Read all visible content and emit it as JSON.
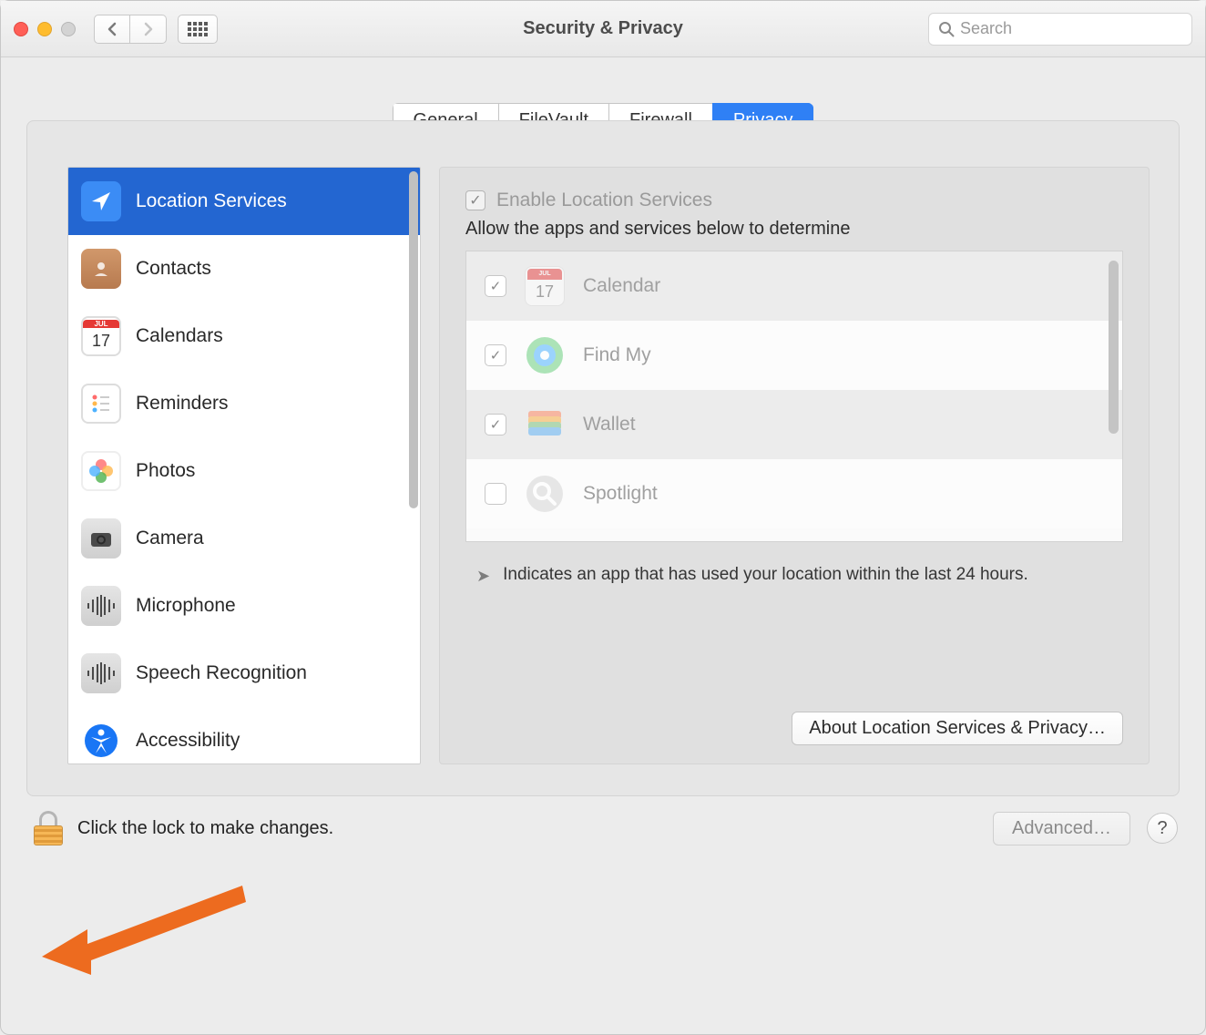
{
  "titlebar": {
    "title": "Security & Privacy",
    "search_placeholder": "Search"
  },
  "tabs": {
    "general": "General",
    "filevault": "FileVault",
    "firewall": "Firewall",
    "privacy": "Privacy"
  },
  "sidebar": {
    "items": [
      {
        "label": "Location Services",
        "icon": "location",
        "selected": true
      },
      {
        "label": "Contacts",
        "icon": "contacts",
        "selected": false
      },
      {
        "label": "Calendars",
        "icon": "calendars",
        "selected": false
      },
      {
        "label": "Reminders",
        "icon": "reminders",
        "selected": false
      },
      {
        "label": "Photos",
        "icon": "photos",
        "selected": false
      },
      {
        "label": "Camera",
        "icon": "camera",
        "selected": false
      },
      {
        "label": "Microphone",
        "icon": "microphone",
        "selected": false
      },
      {
        "label": "Speech Recognition",
        "icon": "speech",
        "selected": false
      },
      {
        "label": "Accessibility",
        "icon": "accessibility",
        "selected": false
      }
    ]
  },
  "content": {
    "enable_label": "Enable Location Services",
    "enable_checked": true,
    "instruction": "Allow the apps and services below to determine",
    "apps": [
      {
        "name": "Calendar",
        "checked": true
      },
      {
        "name": "Find My",
        "checked": true
      },
      {
        "name": "Wallet",
        "checked": true
      },
      {
        "name": "Spotlight",
        "checked": false
      }
    ],
    "note": "Indicates an app that has used your location within the last 24 hours.",
    "about_button": "About Location Services & Privacy…"
  },
  "footer": {
    "lock_text": "Click the lock to make changes.",
    "advanced_button": "Advanced…",
    "help": "?"
  }
}
